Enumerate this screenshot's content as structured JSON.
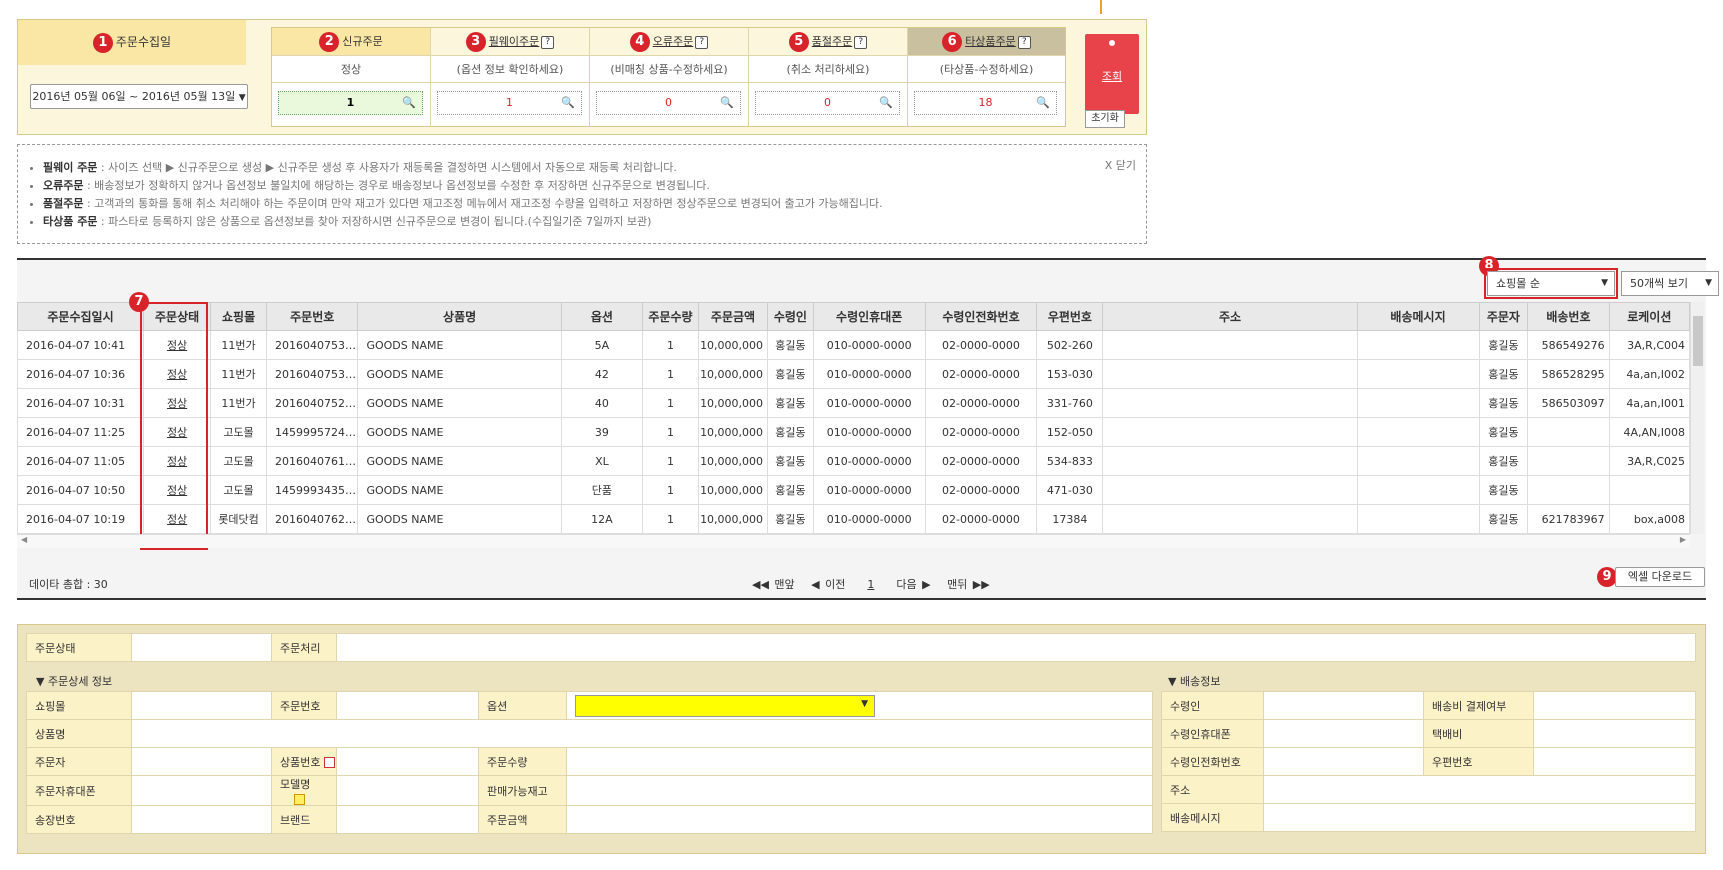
{
  "annotations": {
    "n1": "1",
    "n2": "2",
    "n3": "3",
    "n4": "4",
    "n5": "5",
    "n6": "6",
    "n7": "7",
    "n8": "8",
    "n9": "9"
  },
  "filter": {
    "date_header": "주문수집일",
    "date_range": "2016년 05월 06일 ~ 2016년 05월 13일",
    "statuses": [
      {
        "label": "신규주문",
        "sub": "정상",
        "value": "1"
      },
      {
        "label": "필웨이주문",
        "sub": "(옵션 정보 확인하세요)",
        "value": "1"
      },
      {
        "label": "오류주문",
        "sub": "(비매칭 상품-수정하세요)",
        "value": "0"
      },
      {
        "label": "품절주문",
        "sub": "(취소 처리하세요)",
        "value": "0"
      },
      {
        "label": "타상품주문",
        "sub": "(타상품-수정하세요)",
        "value": "18"
      }
    ],
    "help_mark": "?",
    "search_label": "조회",
    "reset_label": "초기화"
  },
  "info": {
    "close": "X 닫기",
    "lines": [
      {
        "term": "필웨이 주문",
        "text": " : 사이즈 선택 ▶ 신규주문으로 생성 ▶ 신규주문 생성 후 사용자가 재등록을 결정하면 시스템에서 자동으로 재등록 처리합니다."
      },
      {
        "term": "오류주문",
        "text": " : 배송정보가 정확하지 않거나 옵션정보 불일치에 해당하는 경우로 배송정보나 옵션정보를 수정한 후 저장하면 신규주문으로 변경됩니다."
      },
      {
        "term": "품절주문",
        "text": " : 고객과의 통화를 통해 취소 처리해야 하는 주문이며 만약 재고가 있다면 재고조정 메뉴에서 재고조정 수량을 입력하고 저장하면 정상주문으로 변경되어 출고가 가능해집니다."
      },
      {
        "term": "타상품 주문",
        "text": " : 파스타로 등록하지 않은 상품으로 옵션정보를 찾아 저장하시면 신규주문으로 변경이 됩니다.(수집일기준 7일까지 보관)"
      }
    ]
  },
  "grid": {
    "sort_select": "쇼핑몰 순",
    "page_size_select": "50개씩 보기",
    "columns": [
      "주문수집일시",
      "주문상태",
      "쇼핑몰",
      "주문번호",
      "상품명",
      "옵션",
      "주문수량",
      "주문금액",
      "수령인",
      "수령인휴대폰",
      "수령인전화번호",
      "우편번호",
      "주소",
      "배송메시지",
      "주문자",
      "배송번호",
      "로케이션"
    ],
    "rows": [
      [
        "2016-04-07 10:41",
        "정상",
        "11번가",
        "2016040753…",
        "GOODS NAME",
        "5A",
        "1",
        "10,000,000",
        "홍길동",
        "010-0000-0000",
        "02-0000-0000",
        "502-260",
        "",
        "",
        "홍길동",
        "586549276",
        "3A,R,C004"
      ],
      [
        "2016-04-07 10:36",
        "정상",
        "11번가",
        "2016040753…",
        "GOODS NAME",
        "42",
        "1",
        "10,000,000",
        "홍길동",
        "010-0000-0000",
        "02-0000-0000",
        "153-030",
        "",
        "",
        "홍길동",
        "586528295",
        "4a,an,I002"
      ],
      [
        "2016-04-07 10:31",
        "정상",
        "11번가",
        "2016040752…",
        "GOODS NAME",
        "40",
        "1",
        "10,000,000",
        "홍길동",
        "010-0000-0000",
        "02-0000-0000",
        "331-760",
        "",
        "",
        "홍길동",
        "586503097",
        "4a,an,I001"
      ],
      [
        "2016-04-07 11:25",
        "정상",
        "고도몰",
        "1459995724…",
        "GOODS NAME",
        "39",
        "1",
        "10,000,000",
        "홍길동",
        "010-0000-0000",
        "02-0000-0000",
        "152-050",
        "",
        "",
        "홍길동",
        "",
        "4A,AN,I008"
      ],
      [
        "2016-04-07 11:05",
        "정상",
        "고도몰",
        "2016040761…",
        "GOODS NAME",
        "XL",
        "1",
        "10,000,000",
        "홍길동",
        "010-0000-0000",
        "02-0000-0000",
        "534-833",
        "",
        "",
        "홍길동",
        "",
        "3A,R,C025"
      ],
      [
        "2016-04-07 10:50",
        "정상",
        "고도몰",
        "1459993435…",
        "GOODS NAME",
        "단품",
        "1",
        "10,000,000",
        "홍길동",
        "010-0000-0000",
        "02-0000-0000",
        "471-030",
        "",
        "",
        "홍길동",
        "",
        ""
      ],
      [
        "2016-04-07 10:19",
        "정상",
        "롯데닷컴",
        "2016040762…",
        "GOODS NAME",
        "12A",
        "1",
        "10,000,000",
        "홍길동",
        "010-0000-0000",
        "02-0000-0000",
        "17384",
        "",
        "",
        "홍길동",
        "621783967",
        "box,a008"
      ]
    ],
    "total": "데이타 총합 : 30",
    "pager": {
      "first": "◀◀ 맨앞",
      "prev": "◀ 이전",
      "page": "1",
      "next": "다음 ▶",
      "last": "맨뒤 ▶▶"
    },
    "excel": "엑셀 다운로드"
  },
  "detail": {
    "status_label": "주문상태",
    "process_label": "주문처리",
    "order_section": "▼ 주문상세 정보",
    "ship_section": "▼ 배송정보",
    "order_fields": {
      "mall": "쇼핑몰",
      "orderno": "주문번호",
      "option": "옵션",
      "product": "상품명",
      "orderer": "주문자",
      "productno": "상품번호",
      "qty": "주문수량",
      "orderer_phone": "주문자휴대폰",
      "model": "모델명",
      "stock": "판매가능재고",
      "invoice": "송장번호",
      "brand": "브랜드",
      "amount": "주문금액"
    },
    "ship_fields": {
      "recipient": "수령인",
      "fee": "배송비 결제여부",
      "mobile": "수령인휴대폰",
      "courier": "택배비",
      "phone": "수령인전화번호",
      "zip": "우편번호",
      "addr": "주소",
      "msg": "배송메시지"
    },
    "option_color": "#ffff00"
  }
}
